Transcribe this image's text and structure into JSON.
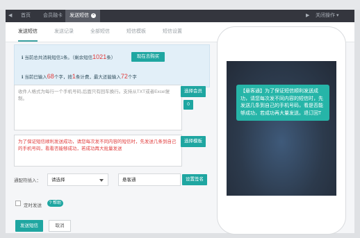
{
  "tabs": {
    "prev_arrow": "◀",
    "home": "首页",
    "recharge": "会员融卡",
    "send": "发送短信",
    "close_icon": "×",
    "next_arrow": "▶",
    "ops": "关闭操作 ▾"
  },
  "subnav": {
    "items": [
      "发送短信",
      "发送记录",
      "全部短信",
      "短信模板",
      "短信设置"
    ]
  },
  "info": {
    "line1_prefix": "当前总共消耗短信1条。（剩余短信",
    "remaining": "1021",
    "line1_suffix": "条）",
    "buy_button": "现在去购买",
    "line2_a": "当前已输入",
    "input_count": "68",
    "line2_b": "个字，按",
    "per_sms": "1",
    "line2_c": "条计费，最大还能输入",
    "max_left": "72",
    "line2_d": "个字"
  },
  "recipients": {
    "placeholder": "收件人格式为每行一个手机号码,后面只有回车换行。支持从TXT或者Excel复制。",
    "select_member_button": "选择会员",
    "count_badge": "0"
  },
  "message": {
    "text": "为了保证短信顺利发送成功，请您每次发不同内容的短信时，先发送几条到自己的手机号码，看看否能够成功，若成功再大批量发送",
    "template_button": "选择模板"
  },
  "signature": {
    "label": "通配符插入：",
    "select_placeholder": "请选择",
    "sign_value": "悬客通",
    "set_sign_button": "设置签名"
  },
  "schedule": {
    "label": "定时发送",
    "help_badge": "? 帮助"
  },
  "actions": {
    "send_button": "发送短信",
    "cancel_button": "取消"
  },
  "preview": {
    "bubble_text": "【悬客通】为了保证短信顺利发送成功，请您每次发不同内容的短信时，先发送几条到自己的手机号码，看是否能够成功，若成功再大量发送。退订回T"
  },
  "colors": {
    "accent": "#1fa6a1",
    "highlight_red": "#e03a3a",
    "tabbar": "#34363e"
  }
}
